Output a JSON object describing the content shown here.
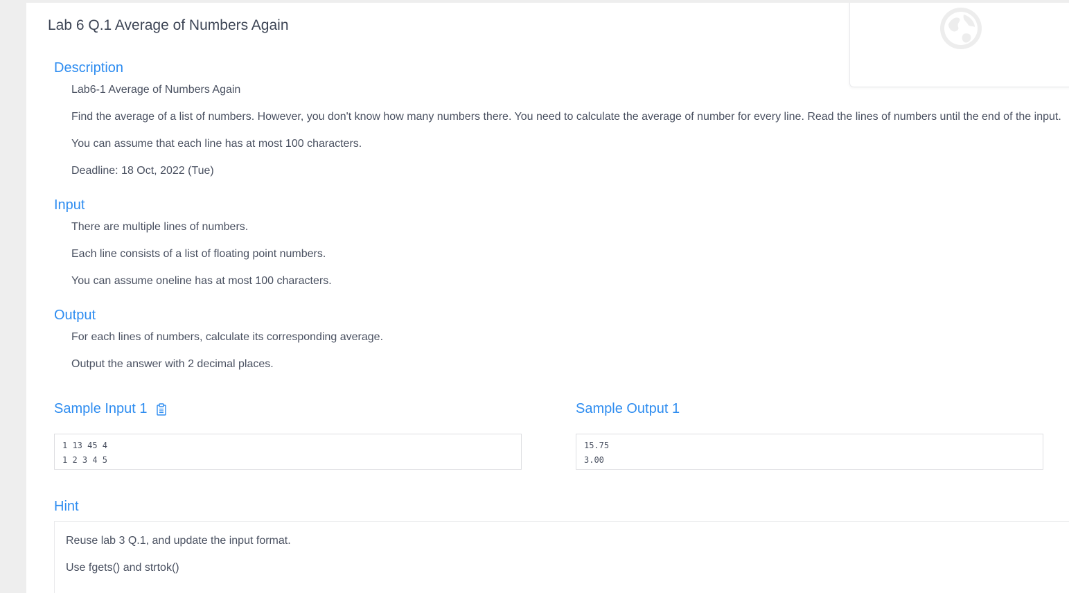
{
  "problem": {
    "title": "Lab 6 Q.1 Average of Numbers Again"
  },
  "description": {
    "heading": "Description",
    "paragraphs": [
      "Lab6-1 Average of Numbers Again",
      "Find the average of a list of numbers. However, you don't know how many numbers there. You need to calculate the average of number for every line. Read the lines of numbers until the end of the input.",
      "You can assume that each line has at most 100 characters.",
      "Deadline: 18 Oct, 2022 (Tue)"
    ]
  },
  "input": {
    "heading": "Input",
    "paragraphs": [
      "There are multiple lines of numbers.",
      "Each line consists of a list of floating point numbers.",
      "You can assume oneline has at most 100 characters."
    ]
  },
  "output": {
    "heading": "Output",
    "paragraphs": [
      "For each lines of numbers, calculate its corresponding average.",
      "Output the answer with 2 decimal places."
    ]
  },
  "sample_input": {
    "heading": "Sample Input 1",
    "lines": [
      "1 13 45 4",
      "1 2 3 4 5"
    ]
  },
  "sample_output": {
    "heading": "Sample Output 1",
    "lines": [
      "15.75",
      "3.00"
    ]
  },
  "hint": {
    "heading": "Hint",
    "lines": [
      "Reuse lab 3 Q.1, and update the input format.",
      "Use fgets() and strtok()"
    ]
  },
  "icons": {
    "copy": "clipboard-icon",
    "globe": "globe-icon"
  },
  "colors": {
    "accent": "#2d8cf0",
    "text": "#495060",
    "background": "#eeeeee"
  }
}
